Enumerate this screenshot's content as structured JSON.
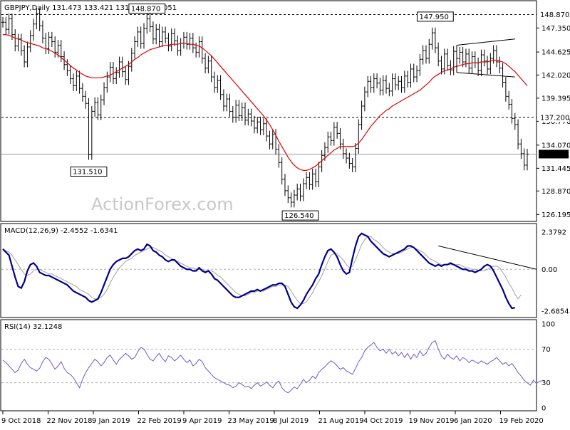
{
  "chart_data": [
    {
      "type": "candlestick",
      "title": "GBPJPY,Daily  131.473 133.421 131.221 133.051",
      "ylim": [
        125.5,
        150.2
      ],
      "y_ticks": [
        "126.195",
        "128.870",
        "131.445",
        "134.070",
        "136.770",
        "139.395",
        "142.020",
        "144.625",
        "147.350"
      ],
      "reference_lines": [
        {
          "value": 148.87,
          "label": "148.870",
          "style": "dashed"
        },
        {
          "value": 137.2,
          "label": "137.200",
          "style": "dashed"
        },
        {
          "value": 133.051,
          "label": "133.051",
          "style": "solid"
        }
      ],
      "annotations": [
        {
          "text": "148.870",
          "x_index": 47,
          "y": 148.87
        },
        {
          "text": "131.510",
          "x_index": 28,
          "y": 131.51
        },
        {
          "text": "126.540",
          "x_index": 97,
          "y": 126.54
        },
        {
          "text": "147.950",
          "x_index": 141,
          "y": 147.95
        }
      ],
      "price_close": [
        148.0,
        147.2,
        148.4,
        146.6,
        145.3,
        146.1,
        144.8,
        143.5,
        145.2,
        146.5,
        147.8,
        149.0,
        147.6,
        146.2,
        145.0,
        146.3,
        145.8,
        144.6,
        145.4,
        144.1,
        143.2,
        142.5,
        141.6,
        140.8,
        141.9,
        140.5,
        139.6,
        138.8,
        133.0,
        137.9,
        138.9,
        137.5,
        139.2,
        140.6,
        141.8,
        142.9,
        141.6,
        142.3,
        143.5,
        142.4,
        141.5,
        143.0,
        144.5,
        145.8,
        146.9,
        145.6,
        147.3,
        148.4,
        147.5,
        146.1,
        147.2,
        145.8,
        146.9,
        146.2,
        145.3,
        146.7,
        145.9,
        144.8,
        145.6,
        146.3,
        145.5,
        146.2,
        145.1,
        144.6,
        145.8,
        143.9,
        142.8,
        143.6,
        141.8,
        140.6,
        141.4,
        139.8,
        138.5,
        139.3,
        137.9,
        137.2,
        138.6,
        137.4,
        138.3,
        136.9,
        137.6,
        136.8,
        136.0,
        136.7,
        135.8,
        136.5,
        135.1,
        134.2,
        135.3,
        133.6,
        132.1,
        130.2,
        128.9,
        128.1,
        127.6,
        128.4,
        129.1,
        128.3,
        129.7,
        130.4,
        129.6,
        130.8,
        129.9,
        131.6,
        132.9,
        133.8,
        135.0,
        134.6,
        136.1,
        135.4,
        134.2,
        133.1,
        132.6,
        132.0,
        131.6,
        133.7,
        136.4,
        138.5,
        140.1,
        141.3,
        140.6,
        141.6,
        141.1,
        140.3,
        141.4,
        140.5,
        140.2,
        141.6,
        140.9,
        141.3,
        140.6,
        141.9,
        141.2,
        142.7,
        141.8,
        142.5,
        143.8,
        144.8,
        143.9,
        145.5,
        146.8,
        145.1,
        143.6,
        142.7,
        144.4,
        143.1,
        142.6,
        144.7,
        143.9,
        144.6,
        143.5,
        144.4,
        142.8,
        144.1,
        143.4,
        142.5,
        144.3,
        143.6,
        142.7,
        143.9,
        144.8,
        143.5,
        142.8,
        141.2,
        139.6,
        138.7,
        137.1,
        136.4,
        134.2,
        133.1,
        131.8,
        133.051
      ],
      "ma_series": [
        146.6,
        146.6,
        146.5,
        146.4,
        146.2,
        146.1,
        146.0,
        145.8,
        145.7,
        145.6,
        145.5,
        145.4,
        145.3,
        145.1,
        145.0,
        144.9,
        144.7,
        144.5,
        144.3,
        144.0,
        143.7,
        143.4,
        143.1,
        142.8,
        142.6,
        142.3,
        142.1,
        141.9,
        141.8,
        141.7,
        141.7,
        141.7,
        141.7,
        141.8,
        141.9,
        142.0,
        142.2,
        142.4,
        142.6,
        142.8,
        143.0,
        143.2,
        143.5,
        143.8,
        144.0,
        144.3,
        144.5,
        144.7,
        144.9,
        145.0,
        145.1,
        145.2,
        145.3,
        145.4,
        145.4,
        145.5,
        145.5,
        145.5,
        145.6,
        145.6,
        145.6,
        145.5,
        145.5,
        145.4,
        145.3,
        145.1,
        144.8,
        144.5,
        144.2,
        143.8,
        143.4,
        143.0,
        142.6,
        142.2,
        141.8,
        141.4,
        141.0,
        140.6,
        140.2,
        139.8,
        139.4,
        139.0,
        138.6,
        138.2,
        137.8,
        137.4,
        136.9,
        136.4,
        135.8,
        135.2,
        134.5,
        133.9,
        133.3,
        132.7,
        132.2,
        131.8,
        131.5,
        131.3,
        131.2,
        131.2,
        131.3,
        131.5,
        131.7,
        132.0,
        132.3,
        132.6,
        132.9,
        133.2,
        133.5,
        133.7,
        133.9,
        133.9,
        133.9,
        133.9,
        133.9,
        134.0,
        134.3,
        134.7,
        135.2,
        135.7,
        136.2,
        136.6,
        137.0,
        137.4,
        137.7,
        138.0,
        138.2,
        138.5,
        138.7,
        138.9,
        139.1,
        139.3,
        139.5,
        139.7,
        139.9,
        140.1,
        140.3,
        140.6,
        140.9,
        141.2,
        141.6,
        141.9,
        142.1,
        142.3,
        142.5,
        142.6,
        142.7,
        142.9,
        143.0,
        143.1,
        143.2,
        143.3,
        143.3,
        143.4,
        143.4,
        143.4,
        143.5,
        143.5,
        143.5,
        143.6,
        143.7,
        143.7,
        143.6,
        143.5,
        143.3,
        143.0,
        142.7,
        142.4,
        142.0,
        141.6,
        141.2,
        140.8
      ]
    },
    {
      "type": "line",
      "title": "MACD(12,26,9) -2.4552 -1.6341",
      "ylim": [
        -3.0,
        2.75
      ],
      "y_ticks": [
        "2.3792",
        "0.00",
        "-2.6854"
      ],
      "series": [
        {
          "name": "MACD",
          "values": [
            1.3,
            1.1,
            0.9,
            0.2,
            -0.5,
            -1.1,
            -1.2,
            -0.8,
            -0.1,
            0.3,
            0.4,
            0.2,
            -0.2,
            -0.3,
            -0.4,
            -0.4,
            -0.5,
            -0.6,
            -0.7,
            -0.8,
            -0.9,
            -1.0,
            -1.2,
            -1.4,
            -1.5,
            -1.6,
            -1.7,
            -1.8,
            -2.0,
            -2.1,
            -2.0,
            -1.9,
            -1.5,
            -1.0,
            -0.5,
            0.0,
            0.3,
            0.5,
            0.6,
            0.7,
            0.7,
            0.8,
            1.0,
            1.2,
            1.3,
            1.2,
            1.3,
            1.6,
            1.5,
            1.2,
            1.1,
            0.9,
            0.8,
            0.6,
            0.5,
            0.6,
            0.6,
            0.4,
            0.2,
            0.1,
            0.0,
            0.0,
            -0.1,
            -0.1,
            0.1,
            -0.1,
            -0.2,
            -0.1,
            -0.3,
            -0.6,
            -0.7,
            -0.9,
            -1.1,
            -1.3,
            -1.5,
            -1.7,
            -1.8,
            -1.8,
            -1.7,
            -1.6,
            -1.5,
            -1.4,
            -1.4,
            -1.3,
            -1.4,
            -1.3,
            -1.2,
            -1.1,
            -1.0,
            -1.0,
            -0.9,
            -0.9,
            -1.1,
            -1.6,
            -2.1,
            -2.4,
            -2.5,
            -2.3,
            -2.0,
            -1.6,
            -1.3,
            -1.0,
            -0.6,
            -0.3,
            0.3,
            0.8,
            1.2,
            1.3,
            1.1,
            0.8,
            0.3,
            -0.1,
            -0.3,
            -0.2,
            0.7,
            1.5,
            2.1,
            2.3,
            2.2,
            2.1,
            1.8,
            1.6,
            1.4,
            1.2,
            1.0,
            0.9,
            0.8,
            0.9,
            1.0,
            1.1,
            1.2,
            1.3,
            1.5,
            1.5,
            1.4,
            1.2,
            1.0,
            0.8,
            0.6,
            0.4,
            0.3,
            0.2,
            0.3,
            0.2,
            0.3,
            0.3,
            0.4,
            0.3,
            0.2,
            0.1,
            0.0,
            0.0,
            -0.1,
            -0.1,
            -0.2,
            -0.1,
            0.0,
            0.2,
            0.3,
            0.2,
            -0.1,
            -0.5,
            -0.9,
            -1.3,
            -1.8,
            -2.2,
            -2.5,
            -2.46
          ],
          "color": "#00008b"
        },
        {
          "name": "Signal",
          "values": [
            1.2,
            1.2,
            1.1,
            0.9,
            0.6,
            0.3,
            0.0,
            -0.3,
            -0.4,
            -0.3,
            -0.1,
            0.0,
            0.0,
            -0.1,
            -0.2,
            -0.3,
            -0.3,
            -0.4,
            -0.5,
            -0.6,
            -0.7,
            -0.8,
            -0.9,
            -1.0,
            -1.1,
            -1.3,
            -1.4,
            -1.5,
            -1.6,
            -1.8,
            -1.9,
            -1.9,
            -1.8,
            -1.6,
            -1.3,
            -0.9,
            -0.5,
            -0.2,
            0.1,
            0.3,
            0.5,
            0.6,
            0.7,
            0.9,
            1.0,
            1.1,
            1.2,
            1.3,
            1.4,
            1.4,
            1.3,
            1.2,
            1.1,
            0.9,
            0.8,
            0.7,
            0.6,
            0.5,
            0.4,
            0.3,
            0.2,
            0.1,
            0.1,
            0.0,
            0.0,
            0.0,
            -0.1,
            -0.1,
            -0.1,
            -0.2,
            -0.4,
            -0.5,
            -0.7,
            -0.9,
            -1.1,
            -1.3,
            -1.5,
            -1.6,
            -1.7,
            -1.7,
            -1.6,
            -1.5,
            -1.5,
            -1.4,
            -1.4,
            -1.4,
            -1.3,
            -1.2,
            -1.1,
            -1.1,
            -1.0,
            -1.0,
            -1.0,
            -1.1,
            -1.4,
            -1.7,
            -2.0,
            -2.2,
            -2.2,
            -2.1,
            -1.8,
            -1.5,
            -1.1,
            -0.8,
            -0.4,
            0.0,
            0.5,
            0.9,
            1.0,
            1.0,
            0.8,
            0.6,
            0.3,
            0.1,
            0.2,
            0.6,
            1.1,
            1.6,
            1.9,
            2.1,
            2.1,
            1.9,
            1.8,
            1.6,
            1.4,
            1.2,
            1.1,
            1.0,
            1.0,
            1.0,
            1.1,
            1.2,
            1.3,
            1.4,
            1.4,
            1.3,
            1.2,
            1.1,
            0.9,
            0.7,
            0.6,
            0.5,
            0.4,
            0.3,
            0.3,
            0.3,
            0.3,
            0.3,
            0.3,
            0.3,
            0.2,
            0.1,
            0.1,
            0.0,
            0.0,
            -0.1,
            -0.1,
            -0.1,
            0.0,
            0.1,
            0.2,
            0.2,
            0.1,
            -0.2,
            -0.5,
            -0.9,
            -1.2,
            -1.6,
            -1.9,
            -1.63
          ],
          "color": "#a0a0a0"
        }
      ],
      "trendline": {
        "from_index": 142,
        "from_value": 1.5,
        "to_index": 172,
        "to_value": 0.0
      }
    },
    {
      "type": "line",
      "title": "RSI(14) 32.1248",
      "ylim": [
        0,
        100
      ],
      "y_ticks": [
        "100",
        "70",
        "30",
        "0"
      ],
      "levels": [
        70,
        30
      ],
      "series": [
        {
          "name": "RSI",
          "values": [
            57,
            54,
            50,
            46,
            42,
            45,
            53,
            58,
            52,
            48,
            46,
            44,
            47,
            55,
            60,
            58,
            52,
            46,
            50,
            55,
            47,
            42,
            40,
            36,
            30,
            24,
            34,
            42,
            48,
            53,
            58,
            55,
            50,
            54,
            60,
            63,
            57,
            52,
            58,
            61,
            65,
            62,
            58,
            60,
            67,
            72,
            70,
            64,
            58,
            56,
            61,
            65,
            59,
            55,
            62,
            60,
            56,
            59,
            63,
            58,
            54,
            57,
            50,
            53,
            58,
            55,
            48,
            44,
            40,
            36,
            34,
            32,
            30,
            28,
            27,
            24,
            26,
            30,
            28,
            25,
            26,
            23,
            27,
            30,
            26,
            28,
            31,
            27,
            24,
            29,
            32,
            24,
            20,
            18,
            21,
            25,
            23,
            28,
            34,
            30,
            33,
            38,
            35,
            42,
            46,
            49,
            53,
            56,
            54,
            50,
            46,
            48,
            44,
            42,
            40,
            47,
            55,
            60,
            68,
            72,
            75,
            78,
            72,
            68,
            70,
            65,
            70,
            64,
            67,
            62,
            66,
            60,
            65,
            58,
            64,
            60,
            68,
            62,
            65,
            72,
            78,
            80,
            70,
            62,
            58,
            64,
            60,
            58,
            62,
            56,
            60,
            58,
            54,
            57,
            55,
            53,
            56,
            54,
            52,
            55,
            57,
            60,
            56,
            52,
            54,
            50,
            53,
            48,
            42,
            38,
            33,
            30,
            27,
            33,
            29,
            32,
            32.12
          ],
          "color": "#6a5acd"
        }
      ]
    }
  ],
  "x_axis": {
    "ticks": [
      "9 Oct 2018",
      "22 Nov 2018",
      "9 Jan 2019",
      "22 Feb 2019",
      "9 Apr 2019",
      "23 May 2019",
      "8 Jul 2019",
      "21 Aug 2019",
      "4 Oct 2019",
      "19 Nov 2019",
      "6 Jan 2020",
      "19 Feb 2020"
    ],
    "tick_index": [
      0,
      16,
      33,
      50,
      67,
      84,
      101,
      118,
      135,
      152,
      169,
      186
    ]
  },
  "watermark": "ActionForex.com"
}
